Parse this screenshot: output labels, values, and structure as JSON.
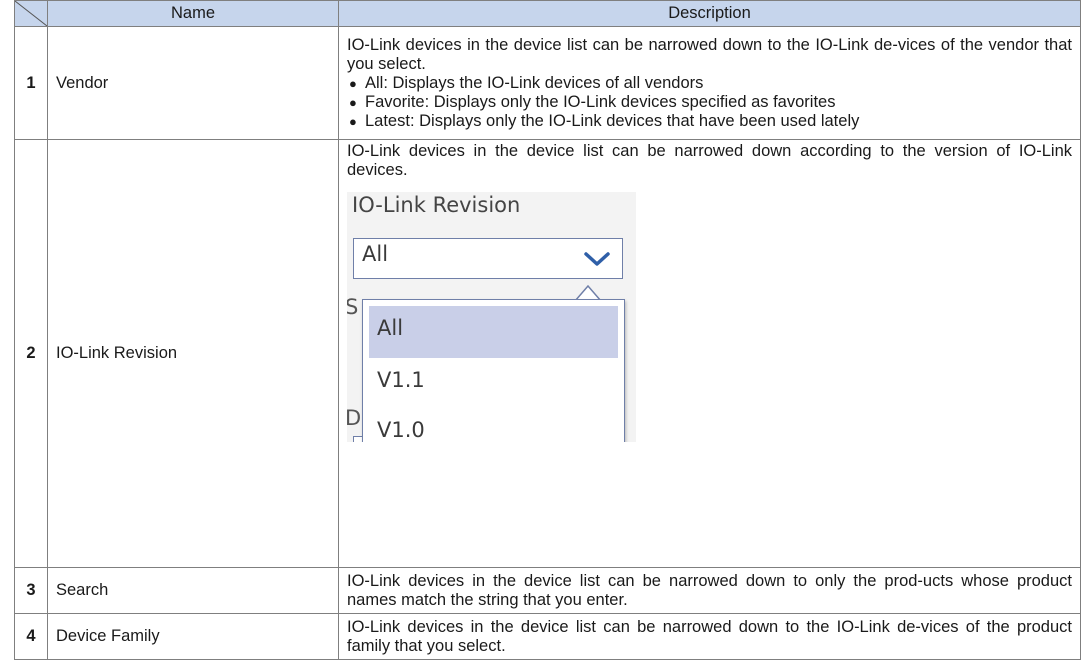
{
  "table": {
    "headers": {
      "name": "Name",
      "description": "Description"
    },
    "rows": [
      {
        "num": "1",
        "name": "Vendor",
        "desc": "IO-Link devices in the device list can be narrowed down to the IO-Link de-vices of the vendor that you select.",
        "bullets": [
          "All: Displays the IO-Link devices of all vendors",
          "Favorite: Displays only the IO-Link devices specified as favorites",
          "Latest: Displays only the IO-Link devices that have been used lately"
        ]
      },
      {
        "num": "2",
        "name": "IO-Link Revision",
        "desc": "IO-Link devices in the device list can be narrowed down according to the version of IO-Link devices.",
        "screenshot": {
          "label": "IO-Link Revision",
          "selected": "All",
          "options": [
            "All",
            "V1.1",
            "V1.0"
          ],
          "partial_below_1": "S",
          "partial_below_2": "D",
          "partial_combo": "All"
        }
      },
      {
        "num": "3",
        "name": "Search",
        "desc": "IO-Link devices in the device list can be narrowed down to only the prod-ucts whose product names match the string that you enter."
      },
      {
        "num": "4",
        "name": "Device Family",
        "desc": "IO-Link devices in the device list can be narrowed down to the IO-Link de-vices of the product family that you select."
      }
    ]
  },
  "colors": {
    "header_bg": "#c6d5ec",
    "border": "#7f7f7f",
    "dropdown_highlight": "#c9cfe8",
    "chevron": "#2f5fa8"
  },
  "icons": [
    "chevron-down-icon",
    "bullet-icon"
  ]
}
